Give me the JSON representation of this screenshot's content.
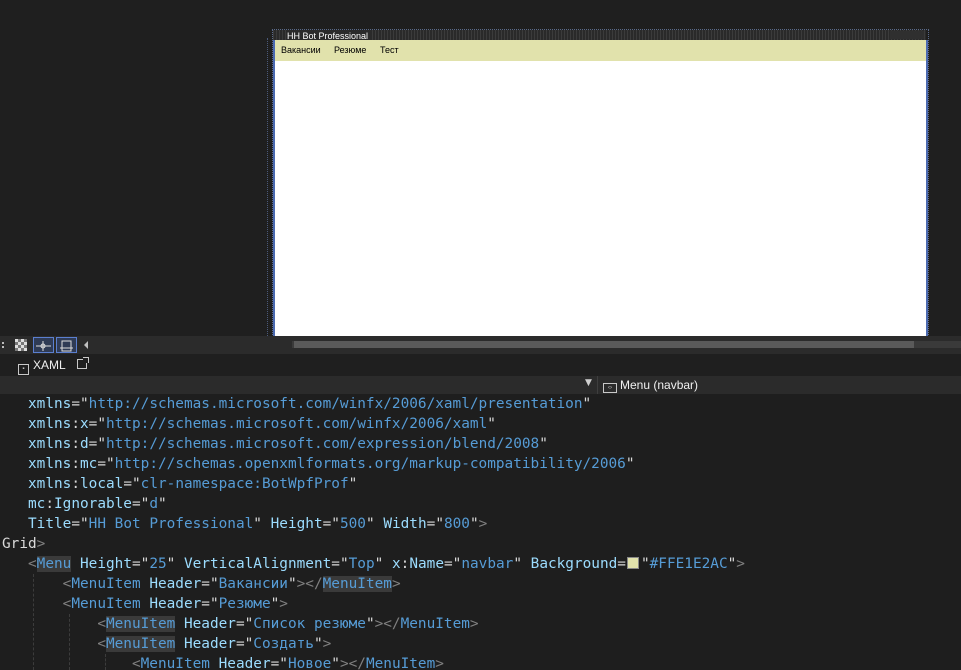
{
  "designer": {
    "window_title": "HH Bot Professional",
    "menu_background": "#E1E2AC",
    "menu_items": [
      "Вакансии",
      "Резюме",
      "Тест"
    ]
  },
  "editor_tabs": {
    "xaml_tab": "XAML"
  },
  "path_bar": {
    "current_element": "Menu (navbar)"
  },
  "code": {
    "xmlns_value": "http://schemas.microsoft.com/winfx/2006/xaml/presentation",
    "xmlns_x_value": "http://schemas.microsoft.com/winfx/2006/xaml",
    "xmlns_d_value": "http://schemas.microsoft.com/expression/blend/2008",
    "xmlns_mc_value": "http://schemas.openxmlformats.org/markup-compatibility/2006",
    "xmlns_local_value": "clr-namespace:BotWpfProf",
    "mc_ignorable_value": "d",
    "title_value": "HH Bot Professional",
    "height_value": "500",
    "width_value": "800",
    "menu_height_value": "25",
    "menu_valign_value": "Top",
    "menu_name_value": "navbar",
    "menu_background_value": "#FFE1E2AC",
    "menuitem1_header": "Вакансии",
    "menuitem2_header": "Резюме",
    "menuitem3_header": "Список резюме",
    "menuitem4_header": "Создать",
    "menuitem5_header": "Новое"
  },
  "colors": {
    "ide_background": "#1e1e1e",
    "xml_element": "#569cd6",
    "xml_attribute": "#9cdcfe",
    "selection_accent": "#5b7fd0"
  }
}
